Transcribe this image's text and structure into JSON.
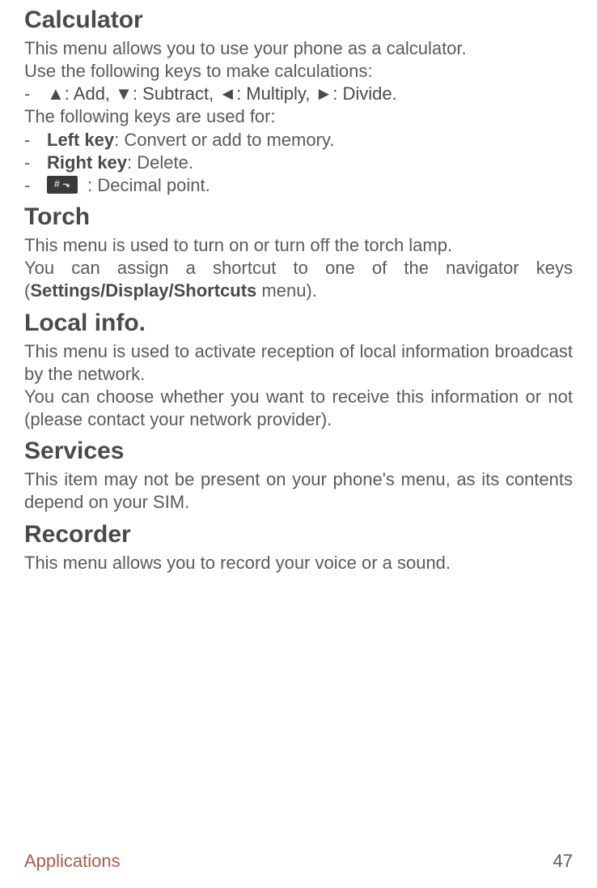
{
  "sections": {
    "calculator": {
      "title": "Calculator",
      "p1": "This menu allows you to use your phone as a calculator.",
      "p2": "Use the following keys to make calculations:",
      "dirline_prefix_a": "▲: Add, ",
      "dirline_prefix_b": "▼: Subtract,  ",
      "dirline_prefix_c": "◄: Multiply, ",
      "dirline_prefix_d": "►: Divide.",
      "p3": "The following keys are used for:",
      "left_key_label": "Left key",
      "left_key_desc": ": Convert or add to memory.",
      "right_key_label": "Right key",
      "right_key_desc": ": Delete.",
      "hash_key_desc": " : Decimal point.",
      "hash_glyph": "# ⬎"
    },
    "torch": {
      "title": "Torch",
      "p1": "This menu is used to turn on or turn off the torch lamp.",
      "p2_a": "You can assign a shortcut to one of the navigator keys (",
      "p2_bold": "Settings/Display/Shortcuts",
      "p2_b": " menu)."
    },
    "local_info": {
      "title": "Local info.",
      "p1": "This menu is used to activate reception of local information broadcast by the network.",
      "p2": "You can choose whether you want to receive this information or not (please contact your network provider)."
    },
    "services": {
      "title": "Services",
      "p1": "This item may not be present on your phone's menu, as its contents depend on your SIM."
    },
    "recorder": {
      "title": "Recorder",
      "p1": "This menu allows you to record your voice or a sound."
    }
  },
  "footer": {
    "left": "Applications",
    "right": "47"
  }
}
